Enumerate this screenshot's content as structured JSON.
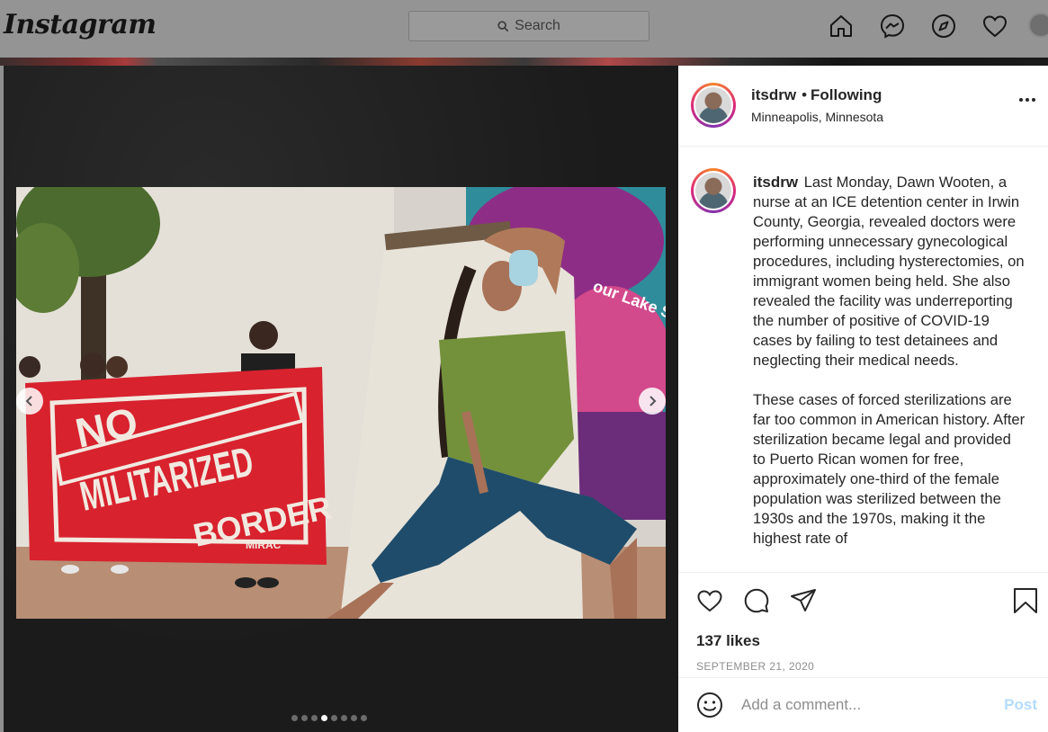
{
  "nav": {
    "logo": "Instagram",
    "search_placeholder": "Search",
    "icons": [
      "home-icon",
      "messenger-icon",
      "explore-icon",
      "heart-icon",
      "profile-avatar"
    ]
  },
  "carousel": {
    "dot_count": 8,
    "active_index": 3,
    "photo_description_text": {
      "banner_line1": "NO",
      "banner_line2": "MILITARIZED",
      "banner_line3": "BORDER",
      "banner_signature": "MIRAC",
      "mural_text": "our Lake Street loves"
    }
  },
  "post": {
    "username": "itsdrw",
    "separator": "•",
    "follow_status": "Following",
    "location": "Minneapolis, Minnesota",
    "caption_paragraph1": "Last Monday, Dawn Wooten, a nurse at an ICE detention center in Irwin County, Georgia, revealed doctors were performing unnecessary gynecological procedures, including hysterectomies, on immigrant women being held. She also revealed the facility was underreporting the number of positive of COVID-19 cases by failing to test detainees and neglecting their medical needs.",
    "caption_paragraph2": "These cases of forced sterilizations are far too common in American history. After sterilization became legal and provided to Puerto Rican women for free, approximately one-third of the female population was sterilized between the 1930s and the 1970s, making it the highest rate of",
    "likes": "137 likes",
    "date": "SEPTEMBER 21, 2020",
    "comment_placeholder": "Add a comment...",
    "post_button": "Post"
  },
  "colors": {
    "story_ring": [
      "#f58529",
      "#dd2a7b",
      "#8134af"
    ],
    "post_button_disabled": "#b3dbff",
    "banner_red": "#d8222e"
  }
}
